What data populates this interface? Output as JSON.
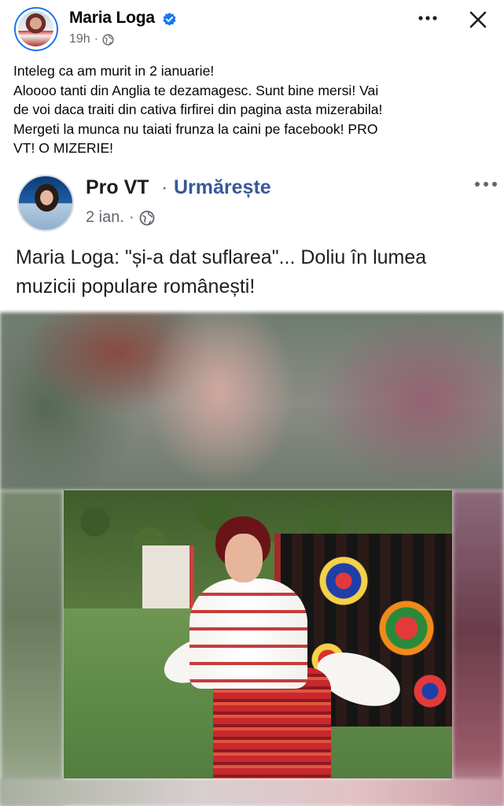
{
  "post": {
    "author": "Maria Loga",
    "time": "19h",
    "separator": "·",
    "text_lines": [
      "Inteleg ca am murit in 2 ianuarie!",
      "Aloooo tanti din Anglia te dezamagesc. Sunt bine mersi! Vai",
      "de voi daca traiti din cativa firfirei din pagina asta mizerabila!",
      "Mergeti la munca nu taiati frunza la caini pe facebook! PRO",
      "VT! O MIZERIE!"
    ]
  },
  "shared_post": {
    "page_name": "Pro VT",
    "separator": "·",
    "follow_label": "Urmărește",
    "time": "2 ian.",
    "meta_separator": "·",
    "headline_lines": [
      "Maria Loga: \"și-a dat suflarea\"... Doliu în lumea",
      "muzicii populare românești!"
    ]
  },
  "icons": {
    "verified": "verified-badge-icon",
    "globe": "globe-icon",
    "more": "more-dots-icon",
    "close": "close-icon"
  },
  "colors": {
    "facebook_blue": "#1877f2",
    "follow_blue": "#385898",
    "secondary_text": "#65676b"
  }
}
